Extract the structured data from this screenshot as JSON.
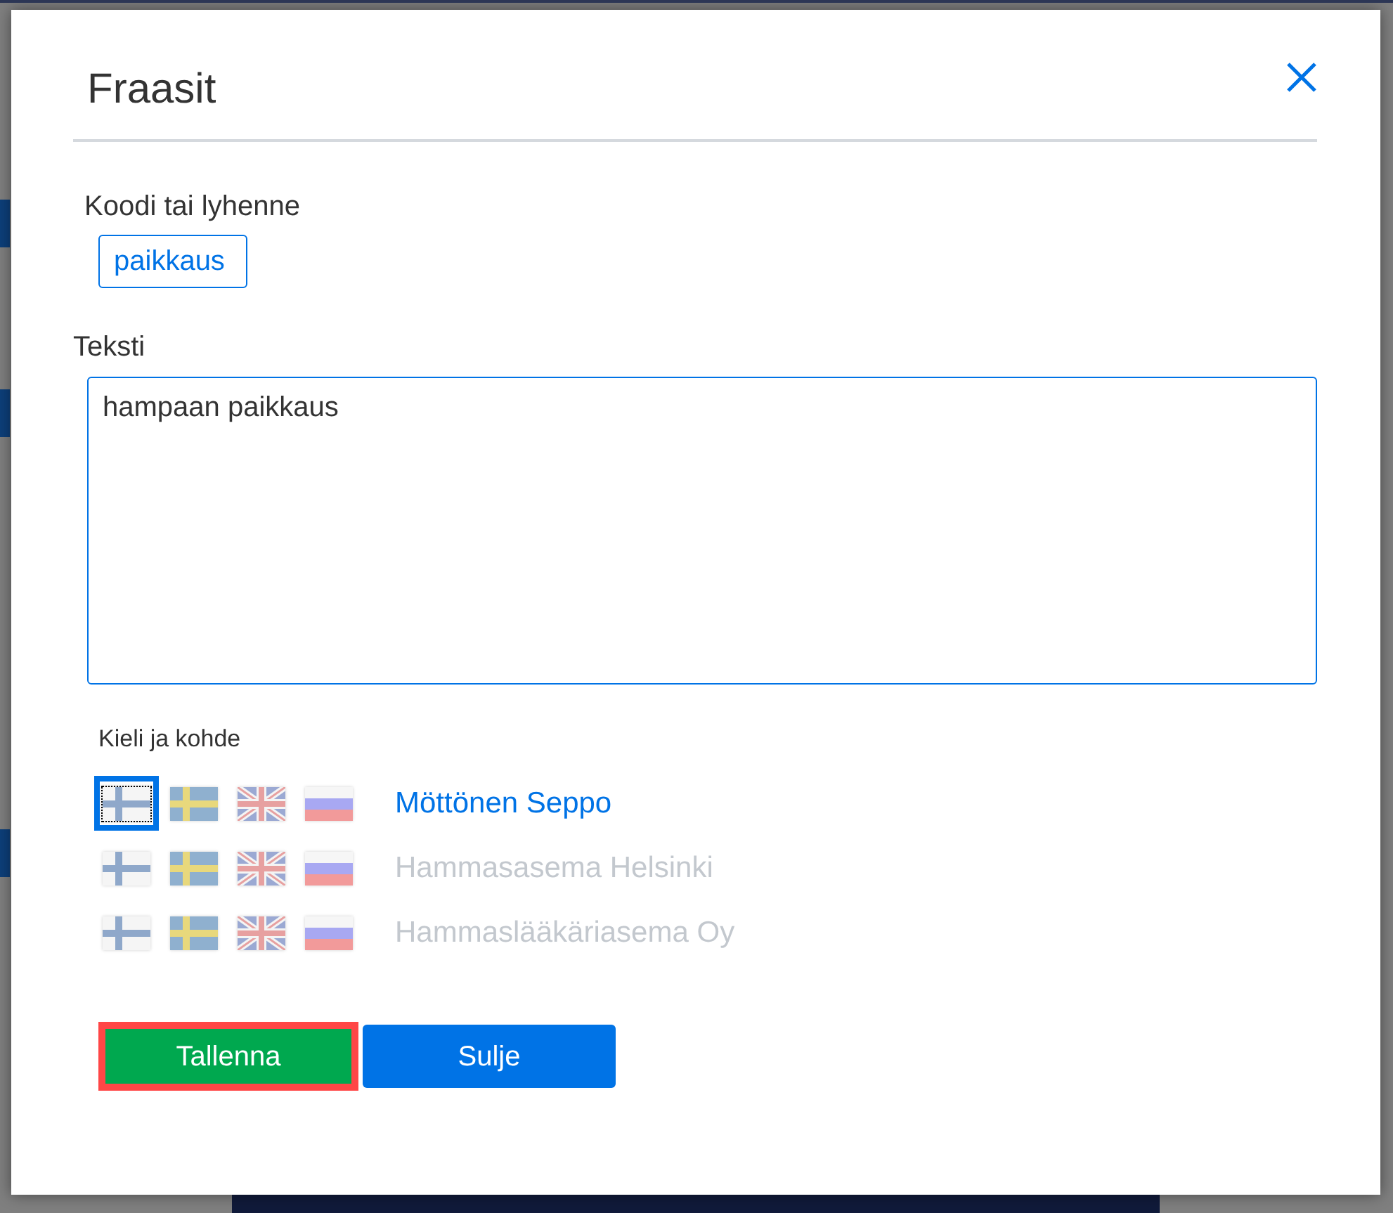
{
  "dialog": {
    "title": "Fraasit"
  },
  "code_field": {
    "label": "Koodi tai lyhenne",
    "value": "paikkaus"
  },
  "text_field": {
    "label": "Teksti",
    "value": "hampaan paikkaus"
  },
  "targets": {
    "label": "Kieli ja kohde",
    "rows": [
      {
        "name": "Möttönen Seppo",
        "selected": true,
        "languages": [
          {
            "kind": "fi",
            "selected": true
          },
          {
            "kind": "se",
            "selected": false
          },
          {
            "kind": "gb",
            "selected": false
          },
          {
            "kind": "ru",
            "selected": false
          }
        ]
      },
      {
        "name": "Hammasasema Helsinki",
        "selected": false,
        "languages": [
          {
            "kind": "fi",
            "selected": false
          },
          {
            "kind": "se",
            "selected": false
          },
          {
            "kind": "gb",
            "selected": false
          },
          {
            "kind": "ru",
            "selected": false
          }
        ]
      },
      {
        "name": "Hammaslääkäriasema Oy",
        "selected": false,
        "languages": [
          {
            "kind": "fi",
            "selected": false
          },
          {
            "kind": "se",
            "selected": false
          },
          {
            "kind": "gb",
            "selected": false
          },
          {
            "kind": "ru",
            "selected": false
          }
        ]
      }
    ]
  },
  "buttons": [
    {
      "label": "Tallenna",
      "kind": "save",
      "focused": true
    },
    {
      "label": "Sulje",
      "kind": "close",
      "focused": false
    }
  ]
}
